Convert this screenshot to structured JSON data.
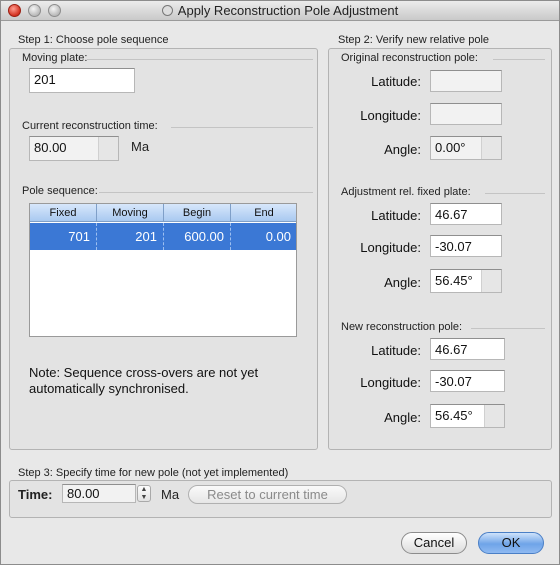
{
  "window": {
    "title": "Apply Reconstruction Pole Adjustment"
  },
  "step1": {
    "heading": "Step 1: Choose pole sequence",
    "moving_plate_label": "Moving plate:",
    "moving_plate_value": "201",
    "time_label": "Current reconstruction time:",
    "time_value": "80.00",
    "time_unit": "Ma",
    "pole_sequence_label": "Pole sequence:",
    "table": {
      "columns": [
        "Fixed",
        "Moving",
        "Begin",
        "End"
      ],
      "rows": [
        {
          "fixed": "701",
          "moving": "201",
          "begin": "600.00",
          "end": "0.00",
          "selected": true
        }
      ]
    },
    "note": "Note: Sequence cross-overs are not yet automatically synchronised."
  },
  "step2": {
    "heading": "Step 2: Verify new relative pole",
    "original": {
      "label": "Original reconstruction pole:",
      "latitude_label": "Latitude:",
      "latitude_value": "",
      "longitude_label": "Longitude:",
      "longitude_value": "",
      "angle_label": "Angle:",
      "angle_value": "0.00°"
    },
    "adjustment": {
      "label": "Adjustment rel. fixed plate:",
      "latitude_label": "Latitude:",
      "latitude_value": "46.67",
      "longitude_label": "Longitude:",
      "longitude_value": "-30.07",
      "angle_label": "Angle:",
      "angle_value": "56.45°"
    },
    "new_pole": {
      "label": "New reconstruction pole:",
      "latitude_label": "Latitude:",
      "latitude_value": "46.67",
      "longitude_label": "Longitude:",
      "longitude_value": "-30.07",
      "angle_label": "Angle:",
      "angle_value": "56.45°"
    }
  },
  "step3": {
    "heading": "Step 3: Specify time for new pole (not yet implemented)",
    "time_label": "Time:",
    "time_value": "80.00",
    "time_unit": "Ma",
    "reset_label": "Reset to current time"
  },
  "buttons": {
    "cancel": "Cancel",
    "ok": "OK"
  },
  "colors": {
    "selection": "#3b78d5",
    "default_button": "#6fa4e8",
    "close_button": "#d2301f"
  }
}
